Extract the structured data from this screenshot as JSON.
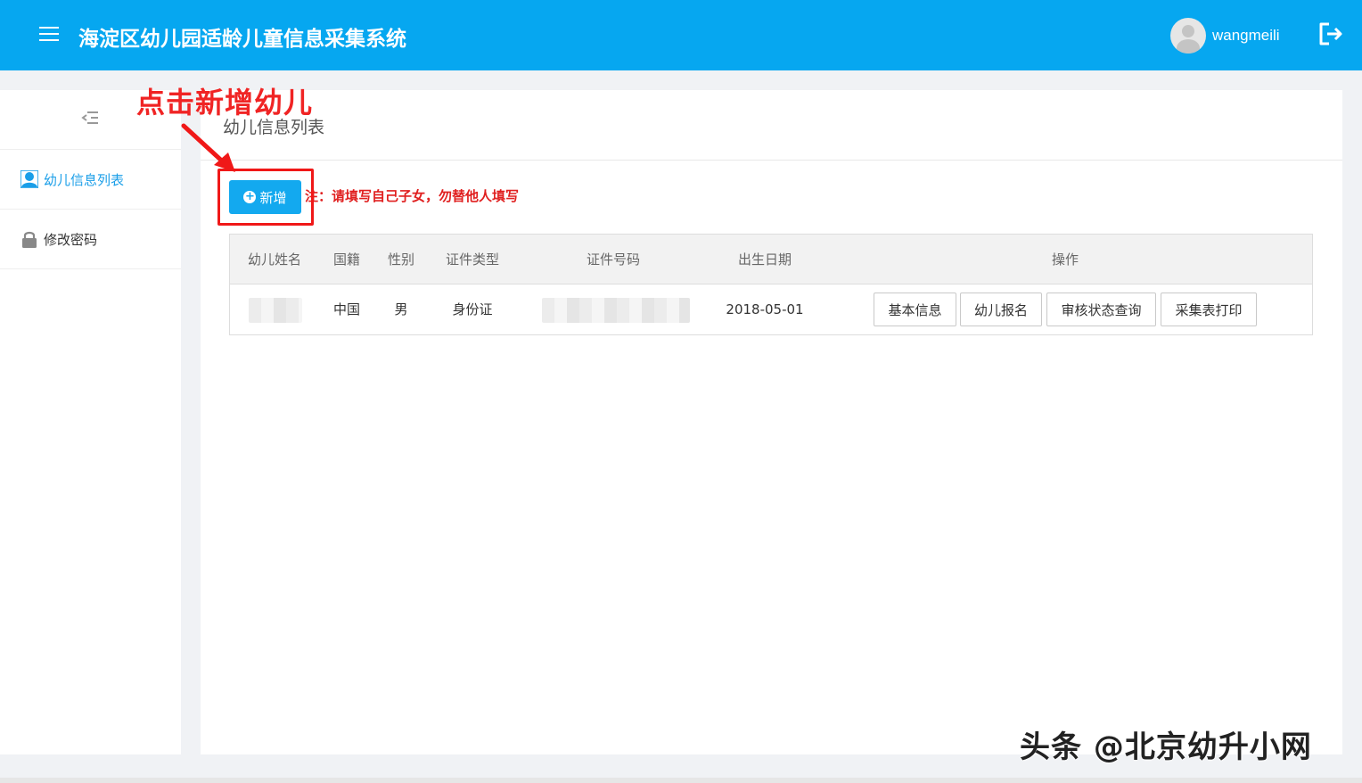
{
  "header": {
    "title": "海淀区幼儿园适龄儿童信息采集系统",
    "username": "wangmeili"
  },
  "sidebar": {
    "items": [
      {
        "label": "幼儿信息列表",
        "icon": "user-icon",
        "active": true
      },
      {
        "label": "修改密码",
        "icon": "lock-icon",
        "active": false
      }
    ]
  },
  "main": {
    "page_title": "幼儿信息列表",
    "add_button_label": "新增",
    "notice": "注：请填写自己子女，勿替他人填写",
    "table": {
      "headers": [
        "幼儿姓名",
        "国籍",
        "性别",
        "证件类型",
        "证件号码",
        "出生日期",
        "操作"
      ],
      "rows": [
        {
          "name": "",
          "nationality": "中国",
          "gender": "男",
          "id_type": "身份证",
          "id_number": "",
          "birth_date": "2018-05-01",
          "actions": [
            "基本信息",
            "幼儿报名",
            "审核状态查询",
            "采集表打印"
          ]
        }
      ]
    }
  },
  "annotation": {
    "text": "点击新增幼儿",
    "color": "#f02424"
  },
  "watermark": "头条 @北京幼升小网",
  "colors": {
    "brand": "#06a7f0",
    "button": "#13a9ef",
    "active_link": "#1a9ee8",
    "notice": "#e02020"
  }
}
